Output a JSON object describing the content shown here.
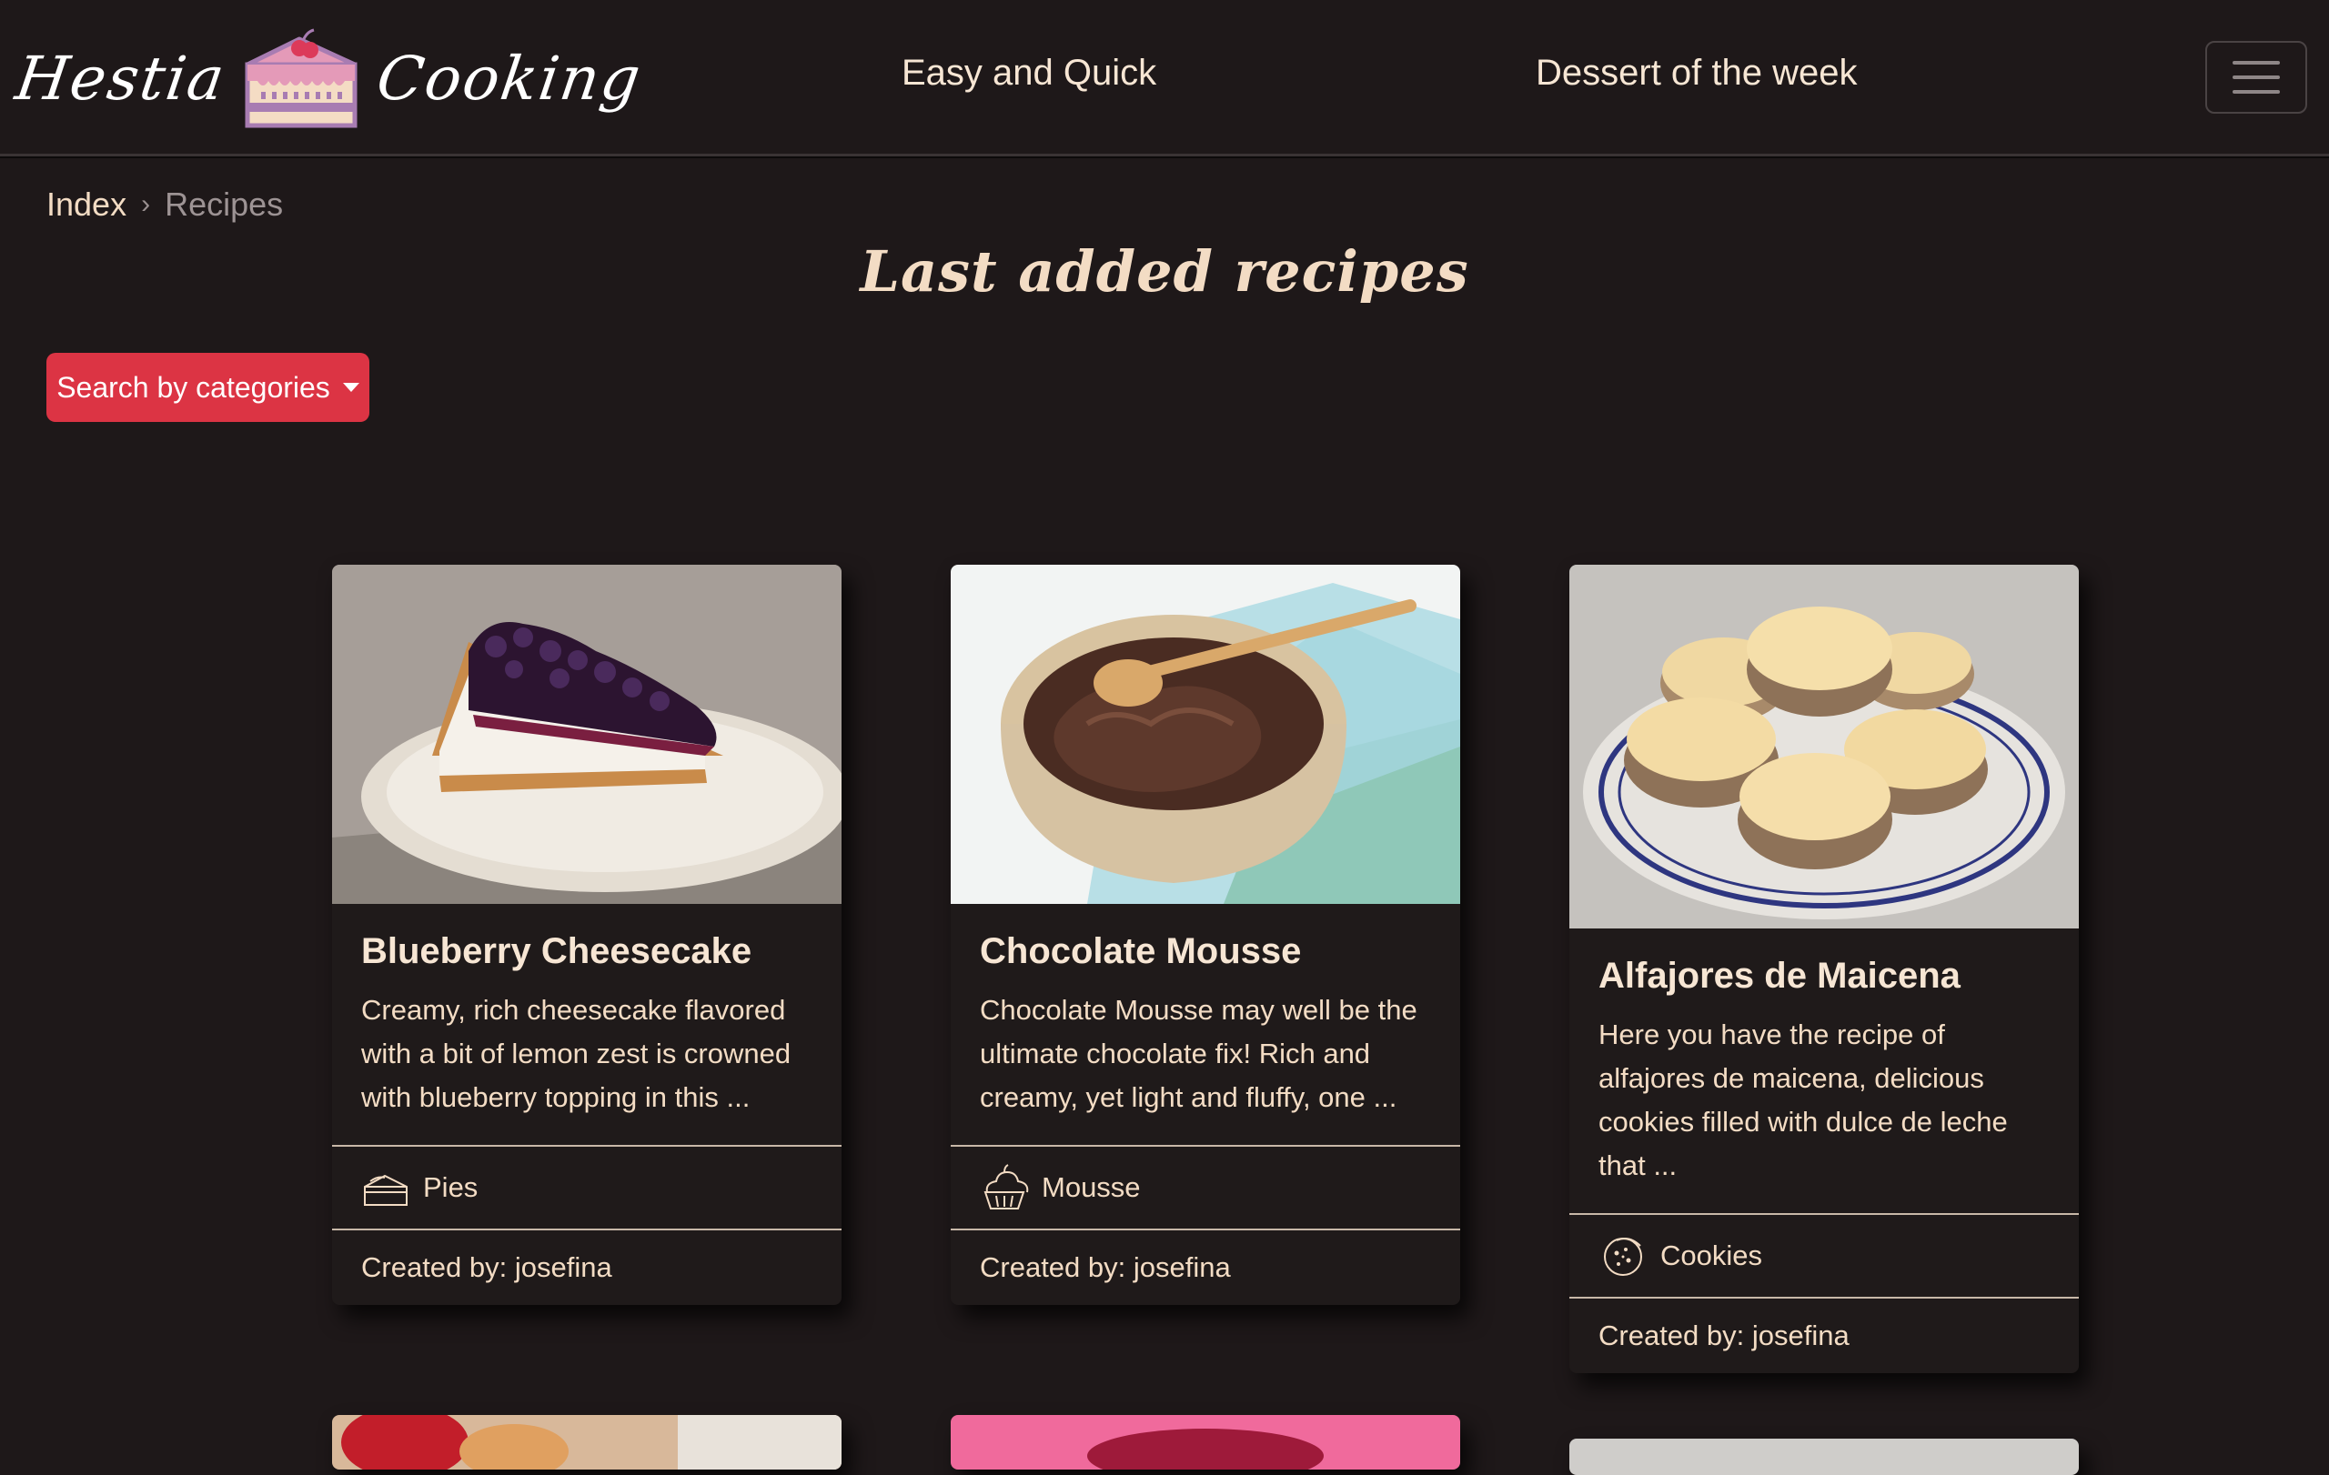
{
  "brand": {
    "word1": "Hestia",
    "word2": "Cooking",
    "logo_icon": "cake-slice-logo"
  },
  "nav": {
    "easy_label": "Easy and Quick",
    "dessert_label": "Dessert of the week",
    "toggler_icon": "hamburger-menu-icon"
  },
  "breadcrumb": {
    "index": "Index",
    "current": "Recipes"
  },
  "page": {
    "title": "Last added recipes"
  },
  "filter": {
    "button_label": "Search by categories"
  },
  "cards": [
    {
      "title": "Blueberry Cheesecake",
      "text": "Creamy, rich cheesecake flavored with a bit of lemon zest is crowned with blueberry topping in this ...",
      "category": "Pies",
      "category_icon": "pie-slice-icon",
      "author": "Created by: josefina"
    },
    {
      "title": "Chocolate Mousse",
      "text": "Chocolate Mousse may well be the ultimate chocolate fix! Rich and creamy, yet light and fluffy, one ...",
      "category": "Mousse",
      "category_icon": "cupcake-icon",
      "author": "Created by: josefina"
    },
    {
      "title": "Alfajores de Maicena",
      "text": "Here you have the recipe of alfajores de maicena, delicious cookies filled with dulce de leche that ...",
      "category": "Cookies",
      "category_icon": "cookie-icon",
      "author": "Created by: josefina"
    }
  ],
  "colors": {
    "background": "#1e1819",
    "accent": "#dc3444",
    "text": "#f3dcc4"
  }
}
